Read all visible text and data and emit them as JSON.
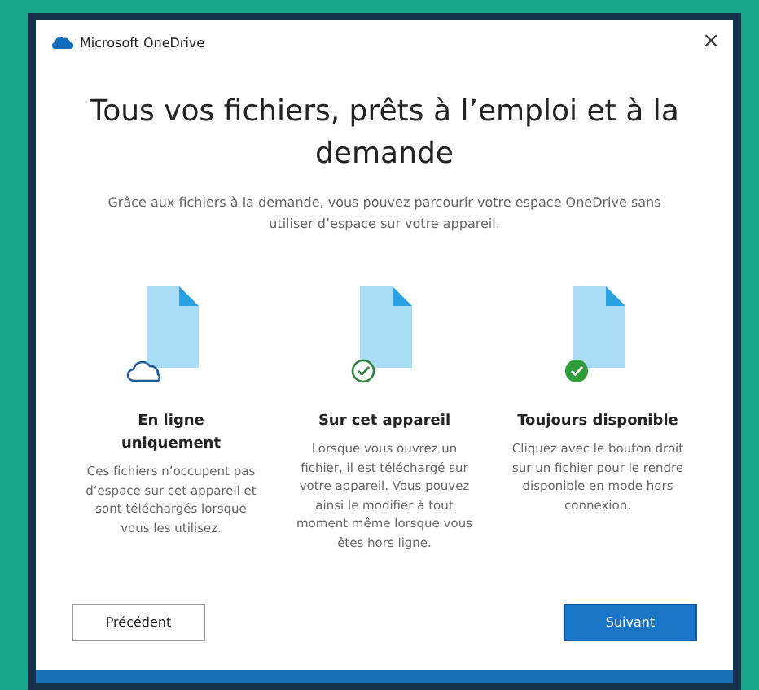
{
  "window": {
    "title": "Microsoft OneDrive",
    "close": "×"
  },
  "heading": "Tous vos fichiers, prêts à l’emploi et à la demande",
  "subtitle": "Grâce aux fichiers à la demande, vous pouvez parcourir votre espace OneDrive sans utiliser d’espace sur votre appareil.",
  "options": [
    {
      "kind": "cloud",
      "title": "En ligne uniquement",
      "text": "Ces fichiers n’occupent pas d’espace sur cet appareil et sont téléchargés lorsque vous les utilisez."
    },
    {
      "kind": "local",
      "title": "Sur cet appareil",
      "text": "Lorsque vous ouvrez un fichier, il est téléchargé sur votre appareil. Vous pouvez ainsi le modifier à tout moment même lorsque vous êtes hors ligne."
    },
    {
      "kind": "always",
      "title": "Toujours disponible",
      "text": "Cliquez avec le bouton droit sur un fichier pour le rendre disponible en mode hors connexion."
    }
  ],
  "buttons": {
    "back": "Précédent",
    "next": "Suivant"
  }
}
